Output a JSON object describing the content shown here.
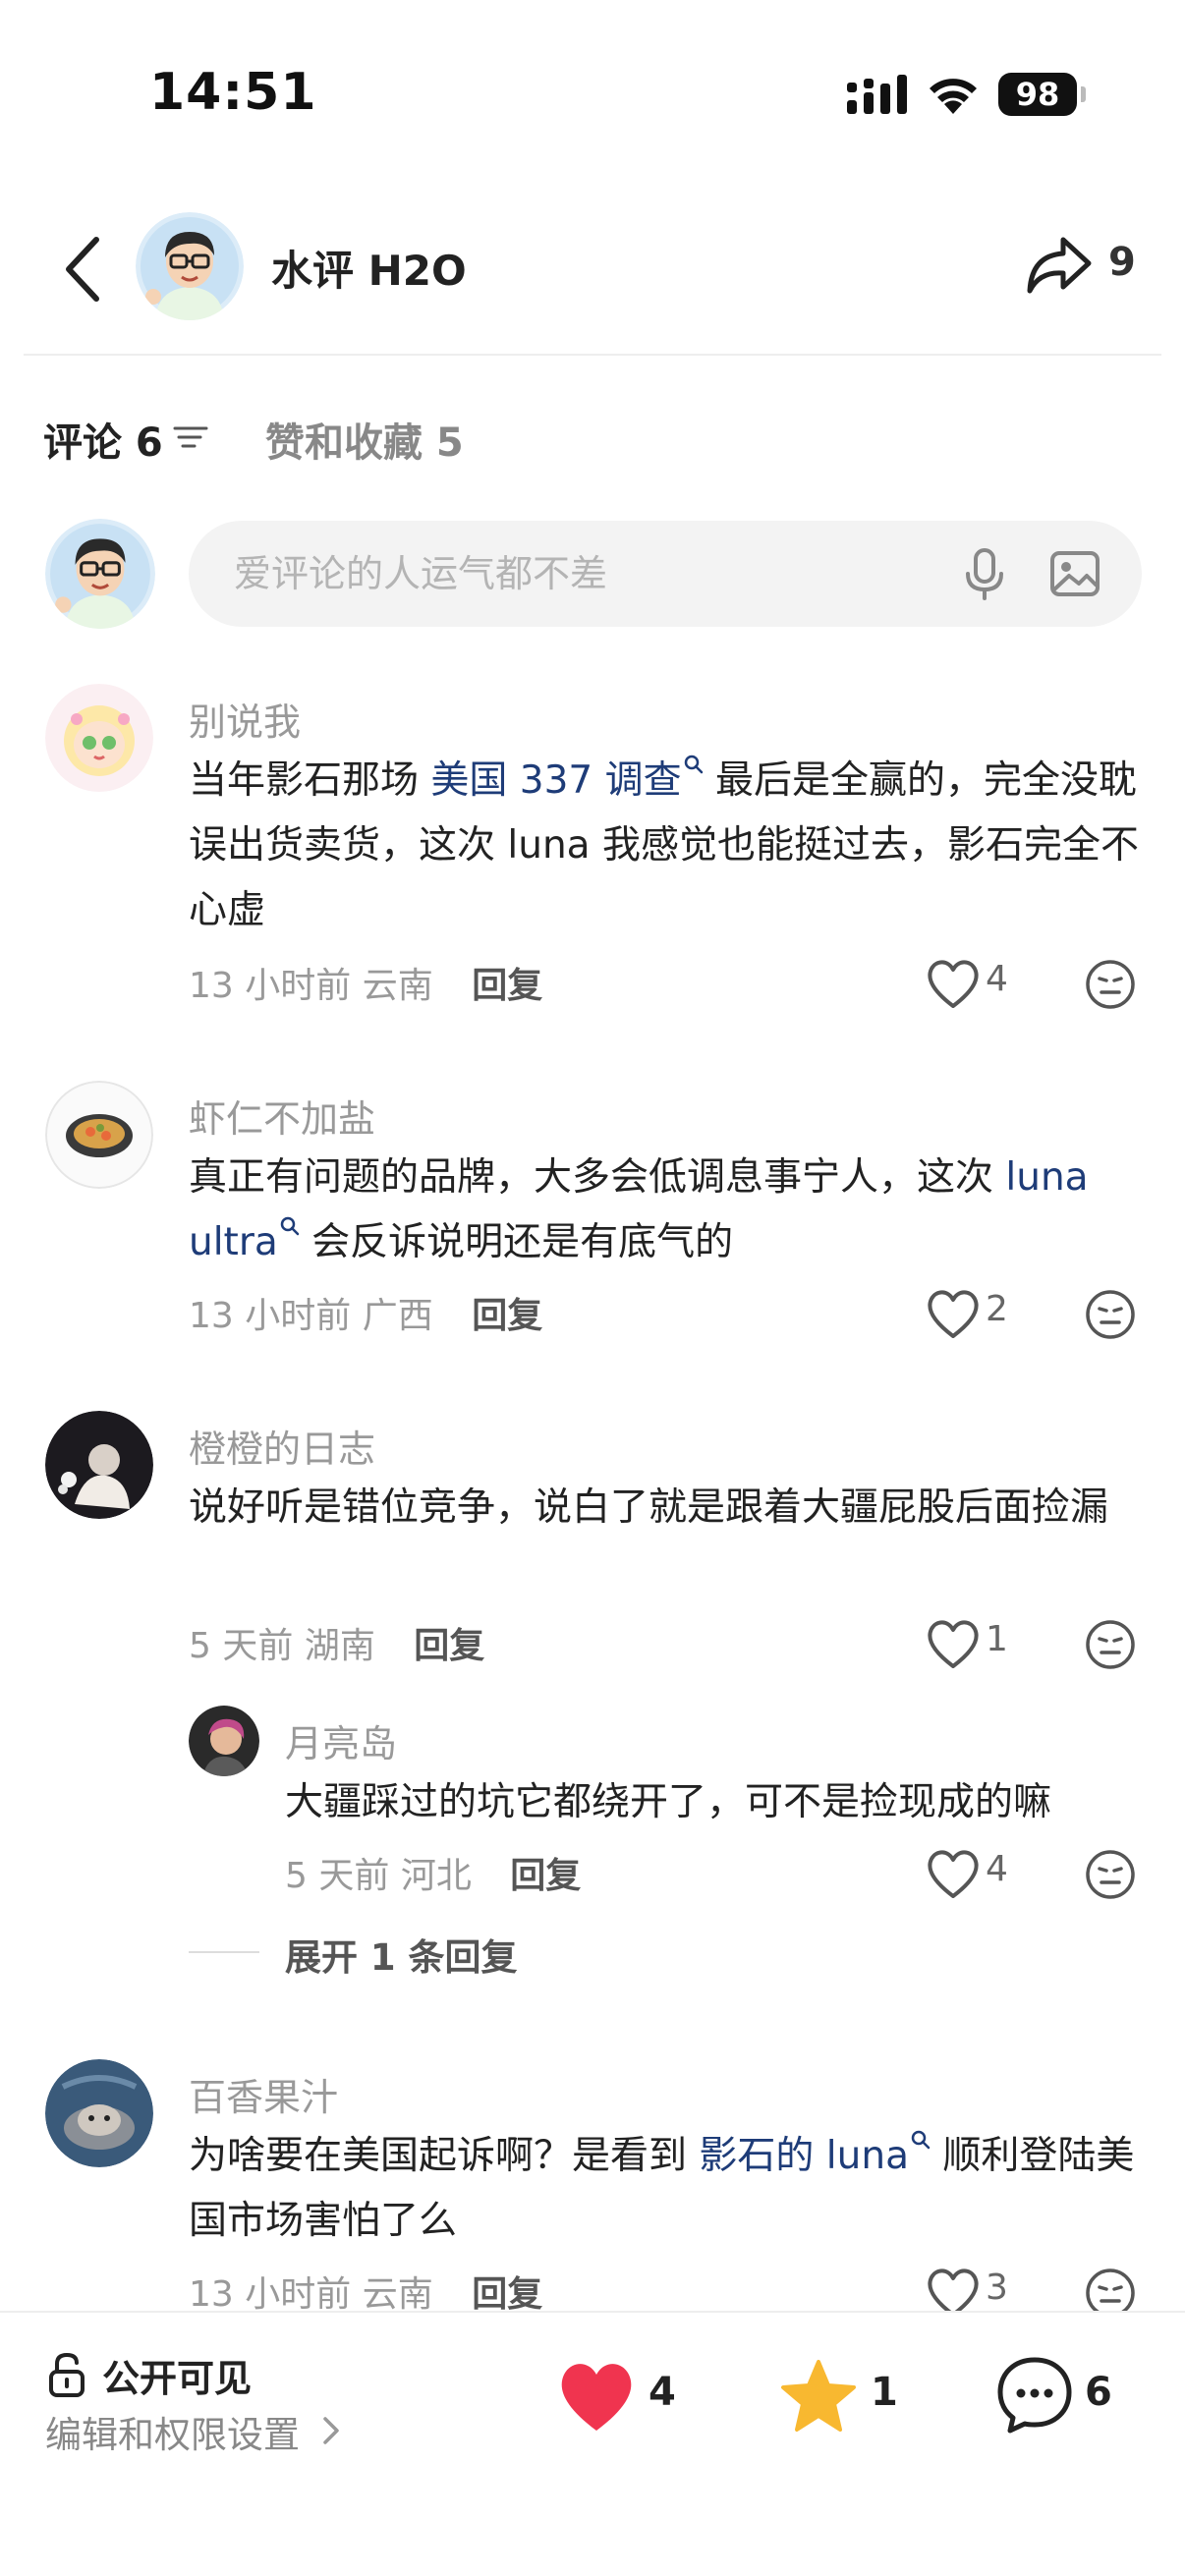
{
  "status_bar": {
    "time": "14:51",
    "battery": "98"
  },
  "header": {
    "title": "水评 H2O",
    "share_count": "9"
  },
  "tabs": {
    "comments_label": "评论 6",
    "likes_label": "赞和收藏 5"
  },
  "input": {
    "placeholder": "爱评论的人运气都不差"
  },
  "comments": [
    {
      "user": "别说我",
      "text_before": "当年影石那场 ",
      "link": "美国 337 调查",
      "text_after": " 最后是全赢的，完全没耽误出货卖货，这次 luna 我感觉也能挺过去，影石完全不心虚",
      "time": "13 小时前",
      "location": "云南",
      "reply_label": "回复",
      "likes": "4"
    },
    {
      "user": "虾仁不加盐",
      "text_before": "真正有问题的品牌，大多会低调息事宁人，这次 ",
      "link": "luna ultra",
      "text_after": " 会反诉说明还是有底气的",
      "time": "13 小时前",
      "location": "广西",
      "reply_label": "回复",
      "likes": "2"
    },
    {
      "user": "橙橙的日志",
      "text": "说好听是错位竞争，说白了就是跟着大疆屁股后面捡漏",
      "time": "5 天前",
      "location": "湖南",
      "reply_label": "回复",
      "likes": "1",
      "reply": {
        "user": "月亮岛",
        "text": "大疆踩过的坑它都绕开了，可不是捡现成的嘛",
        "time": "5 天前",
        "location": "河北",
        "reply_label": "回复",
        "likes": "4"
      },
      "expand_label": "展开 1 条回复"
    },
    {
      "user": "百香果汁",
      "text_before": "为啥要在美国起诉啊？是看到 ",
      "link": "影石的 luna",
      "text_after": " 顺利登陆美国市场害怕了么",
      "time": "13 小时前",
      "location": "云南",
      "reply_label": "回复",
      "likes": "3"
    }
  ],
  "bottom_bar": {
    "visibility": "公开可见",
    "permission_link": "编辑和权限设置",
    "like_count": "4",
    "collect_count": "1",
    "comment_count": "6"
  },
  "colors": {
    "link": "#1e3c78",
    "heart": "#f0344f",
    "star": "#f8b830"
  }
}
